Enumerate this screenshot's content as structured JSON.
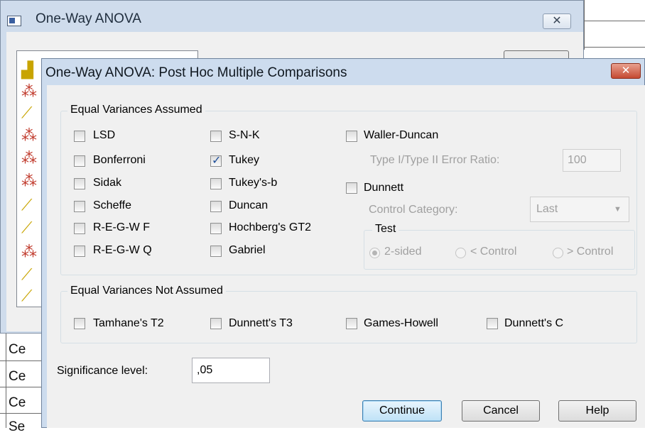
{
  "background": {
    "cells": [
      "Ce",
      "Ce",
      "Ce",
      "Se"
    ]
  },
  "parent": {
    "title": "One-Way ANOVA",
    "close_glyph": "✕"
  },
  "dialog": {
    "title": "One-Way ANOVA: Post Hoc Multiple Comparisons",
    "close_glyph": "✕",
    "equal_assumed": {
      "label": "Equal Variances Assumed",
      "col1": [
        "LSD",
        "Bonferroni",
        "Sidak",
        "Scheffe",
        "R-E-G-W F",
        "R-E-G-W Q"
      ],
      "col2": [
        "S-N-K",
        "Tukey",
        "Tukey's-b",
        "Duncan",
        "Hochberg's GT2",
        "Gabriel"
      ],
      "waller_duncan": "Waller-Duncan",
      "ratio_label": "Type I/Type II Error Ratio:",
      "ratio_value": "100",
      "dunnett": "Dunnett",
      "control_label": "Control Category:",
      "control_value": "Last",
      "test_label": "Test",
      "test_options": [
        "2-sided",
        "< Control",
        "> Control"
      ]
    },
    "equal_not_assumed": {
      "label": "Equal Variances Not Assumed",
      "options": [
        "Tamhane's T2",
        "Dunnett's T3",
        "Games-Howell",
        "Dunnett's C"
      ]
    },
    "significance": {
      "label": "Significance level:",
      "value": ",05"
    },
    "buttons": {
      "continue": "Continue",
      "cancel": "Cancel",
      "help": "Help"
    }
  }
}
